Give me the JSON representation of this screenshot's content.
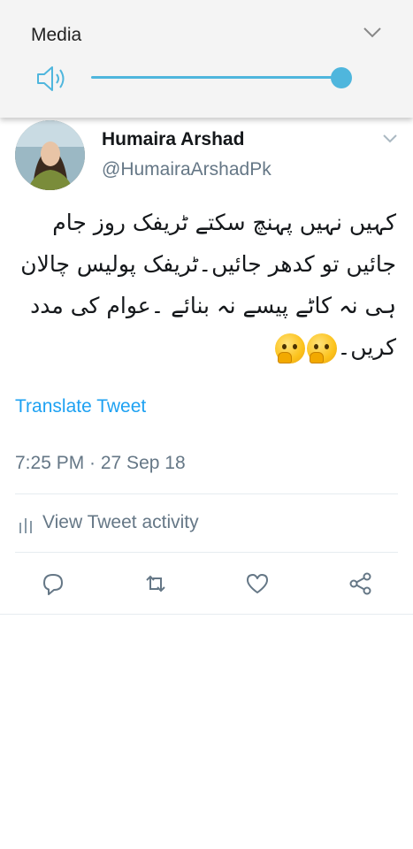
{
  "media_panel": {
    "title": "Media",
    "volume_fraction": 0.97,
    "accent_color": "#4fb6dd",
    "icons": [
      "speaker-icon",
      "chevron-down-icon"
    ]
  },
  "tweet": {
    "display_name": "Humaira Arshad",
    "handle": "@HumairaArshadPk",
    "text": "کہیں نہیں پہنچ سکتے ٹریفک روز جام جائیں تو کدھر جائیں۔ٹریفک پولیس چالان ہی نہ کاٹے پیسے نہ بنائے ۔عوام کی مدد کریں۔",
    "emoji_count": 2,
    "translate_label": "Translate Tweet",
    "timestamp": "7:25 PM · 27 Sep 18",
    "activity_label": "View Tweet activity",
    "link_color": "#1da1f2",
    "actions": [
      "reply-icon",
      "retweet-icon",
      "like-icon",
      "share-icon"
    ]
  }
}
